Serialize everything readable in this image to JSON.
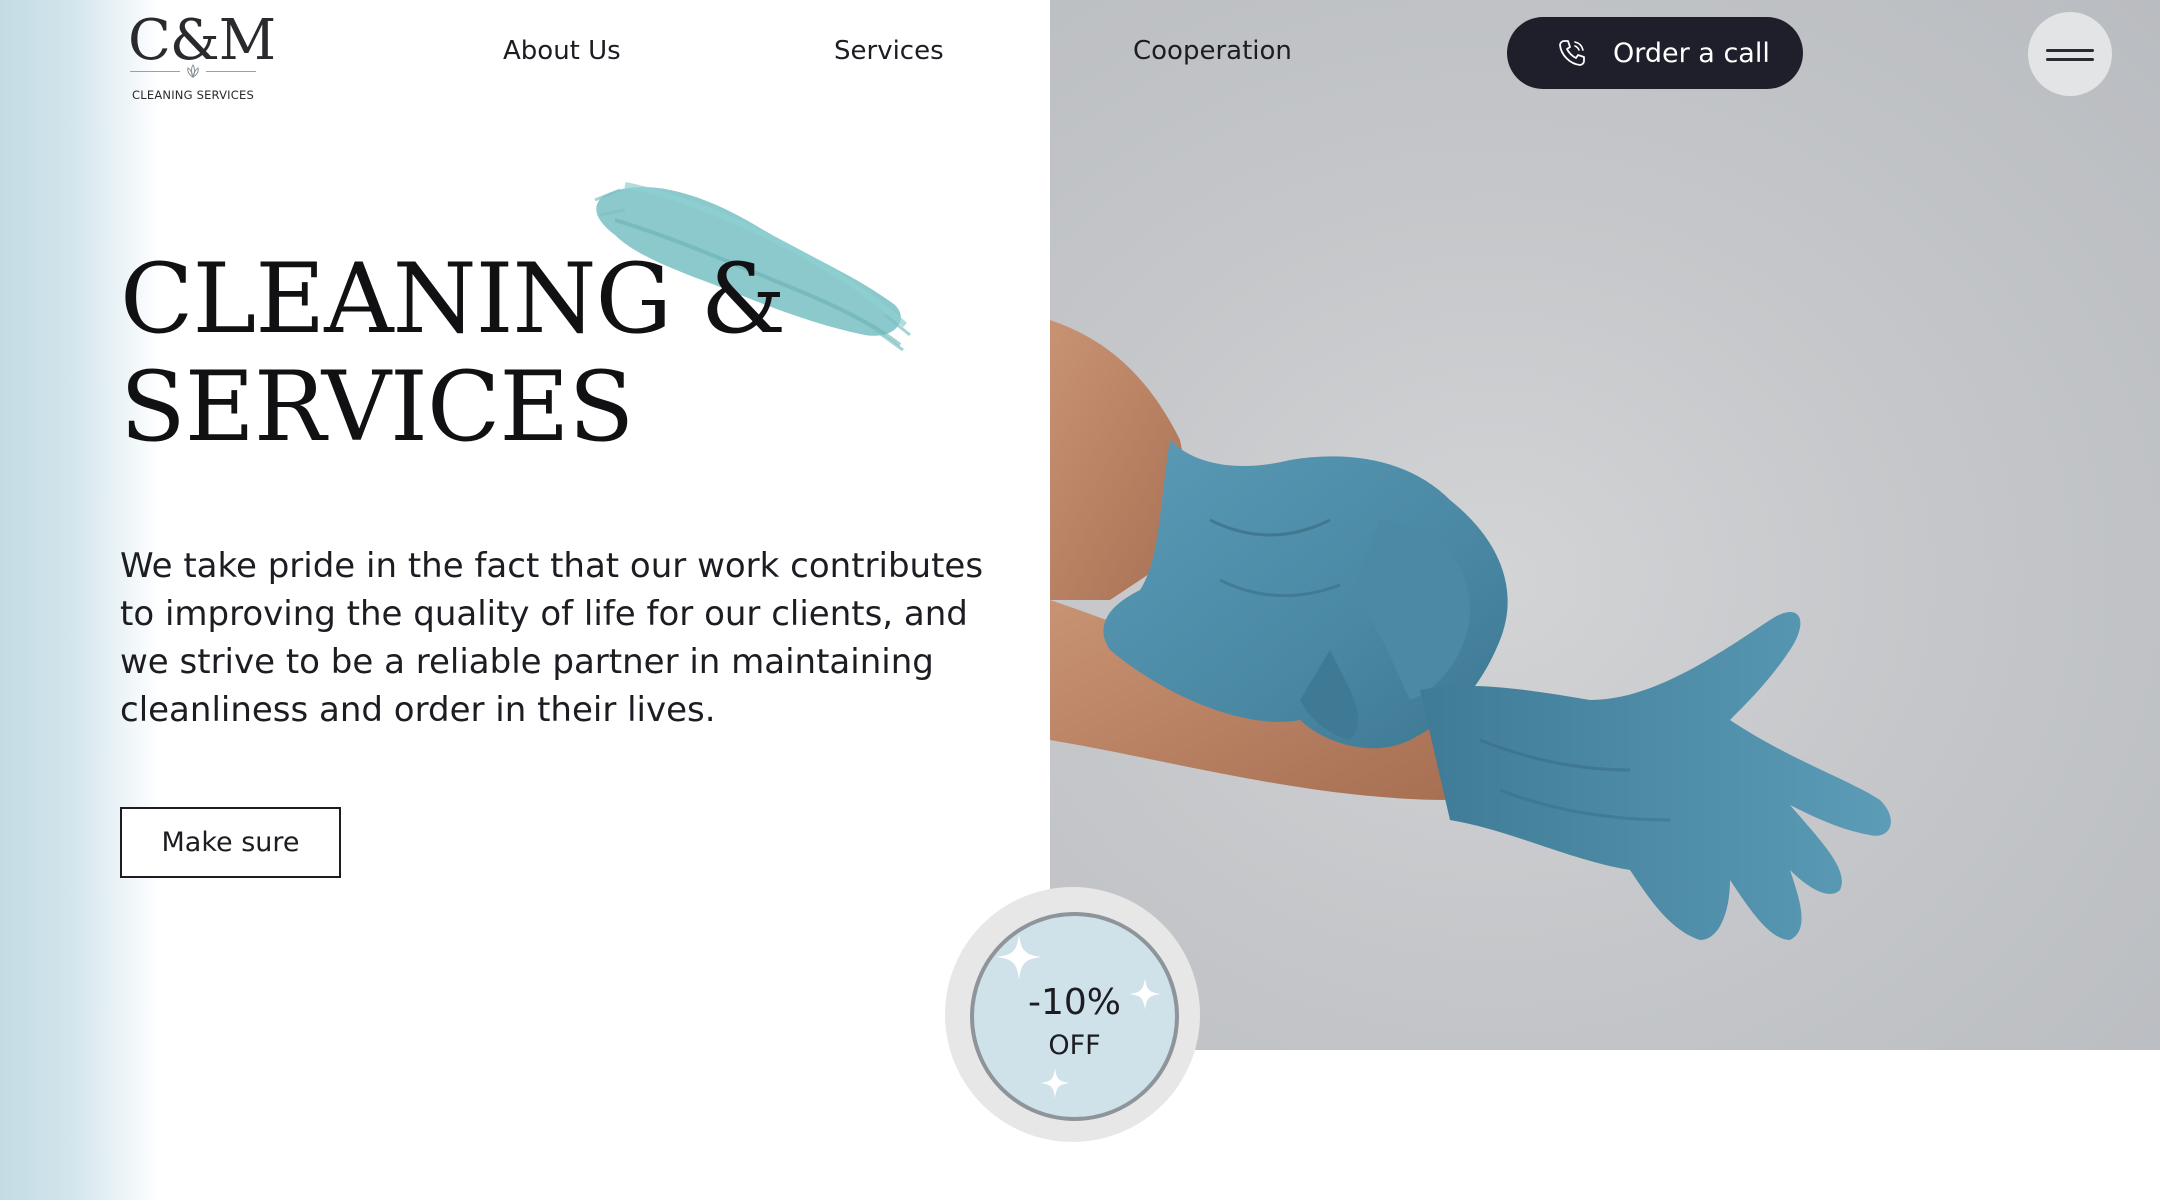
{
  "logo": {
    "mark": "C&M",
    "subtitle": "CLEANING SERVICES",
    "leaf_icon": "lotus-icon"
  },
  "nav": {
    "items": [
      {
        "label": "About Us"
      },
      {
        "label": "Services"
      },
      {
        "label": "Cooperation"
      }
    ],
    "order_call": {
      "label": "Order a call",
      "icon": "phone-icon"
    },
    "menu_icon": "hamburger-menu-icon"
  },
  "hero": {
    "title_line1": "CLEANING &",
    "title_line2": "SERVICES",
    "description": "We take pride in the fact that our work contributes to improving the quality of life for our clients, and we strive to be a reliable partner in maintaining cleanliness and order in their lives.",
    "cta_label": "Make sure",
    "image_subject": "hands-pulling-on-blue-gloves"
  },
  "badge": {
    "value": "-10%",
    "label": "OFF"
  },
  "colors": {
    "accent_teal": "#7ec3c6",
    "dark_button": "#1f1f2b",
    "glove_blue": "#4f8eaa",
    "badge_fill": "#cfe2ea"
  }
}
